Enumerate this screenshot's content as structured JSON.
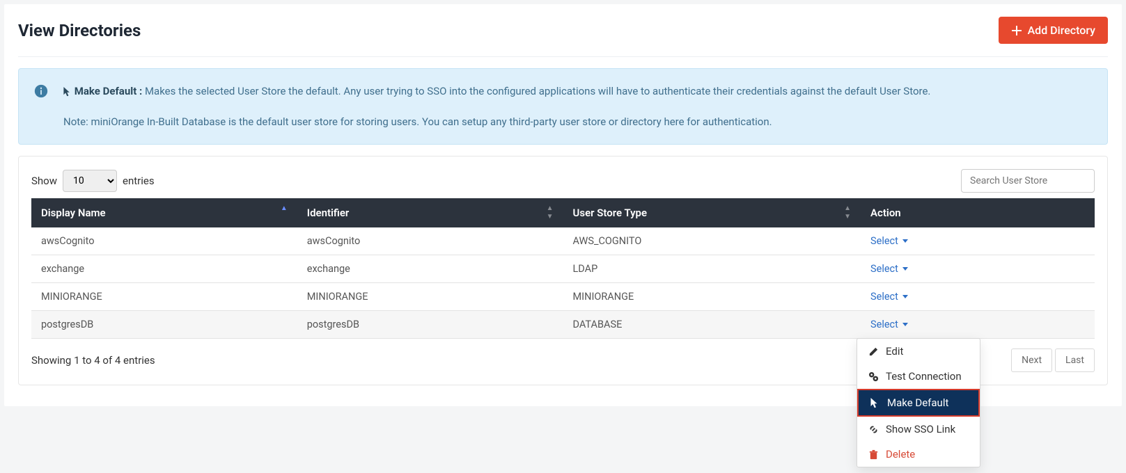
{
  "header": {
    "title": "View Directories",
    "add_button": "Add Directory"
  },
  "info": {
    "make_default_label": "Make Default :",
    "make_default_text": " Makes the selected User Store the default. Any user trying to SSO into the configured applications will have to authenticate their credentials against the default User Store.",
    "note_text": "Note: miniOrange In-Built Database is the default user store for storing users. You can setup any third-party user store or directory here for authentication."
  },
  "table": {
    "show_label": "Show",
    "show_value": "10",
    "entries_label": "entries",
    "search_placeholder": "Search User Store",
    "columns": {
      "display_name": "Display Name",
      "identifier": "Identifier",
      "user_store_type": "User Store Type",
      "action": "Action"
    },
    "select_label": "Select",
    "rows": [
      {
        "display_name": "awsCognito",
        "identifier": "awsCognito",
        "user_store_type": "AWS_COGNITO"
      },
      {
        "display_name": "exchange",
        "identifier": "exchange",
        "user_store_type": "LDAP"
      },
      {
        "display_name": "MINIORANGE",
        "identifier": "MINIORANGE",
        "user_store_type": "MINIORANGE"
      },
      {
        "display_name": "postgresDB",
        "identifier": "postgresDB",
        "user_store_type": "DATABASE"
      }
    ],
    "showing_text": "Showing 1 to 4 of 4 entries",
    "pagination": {
      "next": "Next",
      "last": "Last"
    }
  },
  "dropdown": {
    "edit": "Edit",
    "test": "Test Connection",
    "make_default": "Make Default",
    "show_sso": "Show SSO Link",
    "del": "Delete"
  }
}
